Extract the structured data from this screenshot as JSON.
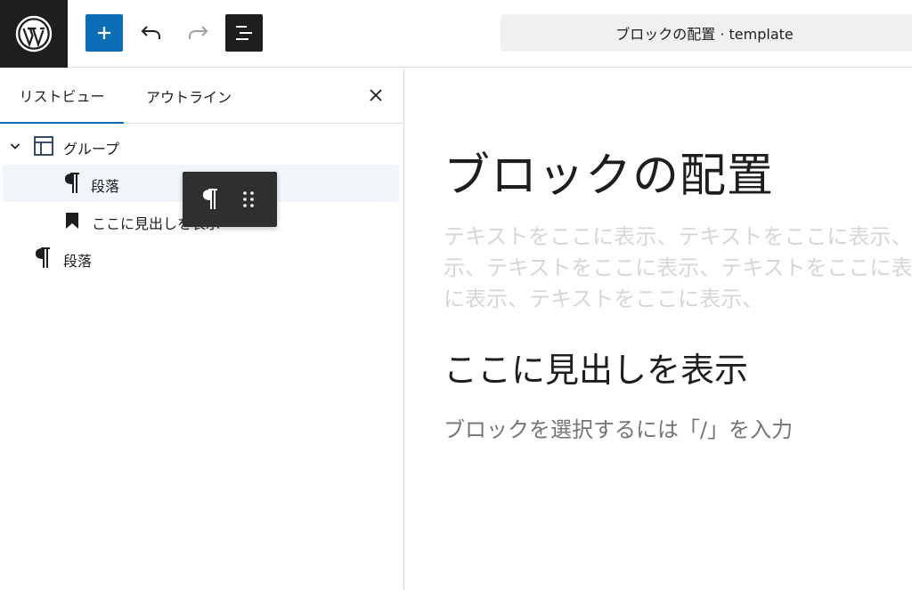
{
  "toolbar": {
    "logo_icon": "wordpress-logo",
    "add_icon": "plus-icon",
    "undo_icon": "undo-icon",
    "redo_icon": "redo-icon",
    "list_view_icon": "list-view-icon",
    "document_title": "ブロックの配置 · template"
  },
  "sidebar": {
    "tabs": [
      {
        "label": "リストビュー",
        "active": true
      },
      {
        "label": "アウトライン",
        "active": false
      }
    ],
    "close_icon": "close-icon",
    "tree": [
      {
        "label": "グループ",
        "icon": "group-icon",
        "level": 1,
        "expanded": true
      },
      {
        "label": "段落",
        "icon": "paragraph-icon",
        "level": 2,
        "selected": true
      },
      {
        "label": "ここに見出しを表示",
        "icon": "heading-bookmark-icon",
        "level": 2
      },
      {
        "label": "段落",
        "icon": "paragraph-icon",
        "level": 1
      }
    ],
    "drag_toolbar": {
      "block_icon": "paragraph-icon",
      "handle_icon": "drag-handle-icon"
    }
  },
  "editor": {
    "title": "ブロックの配置",
    "placeholder_lines": [
      "テキストをここに表示、テキストをここに表示、",
      "示、テキストをここに表示、テキストをここに表",
      "に表示、テキストをここに表示、"
    ],
    "heading": "ここに見出しを表示",
    "appender": "ブロックを選択するには「/」を入力"
  },
  "colors": {
    "accent": "#0a6db5",
    "dark": "#1e1e1e",
    "selected_row": "#f2f6fa",
    "placeholder": "#d6d6d6"
  }
}
